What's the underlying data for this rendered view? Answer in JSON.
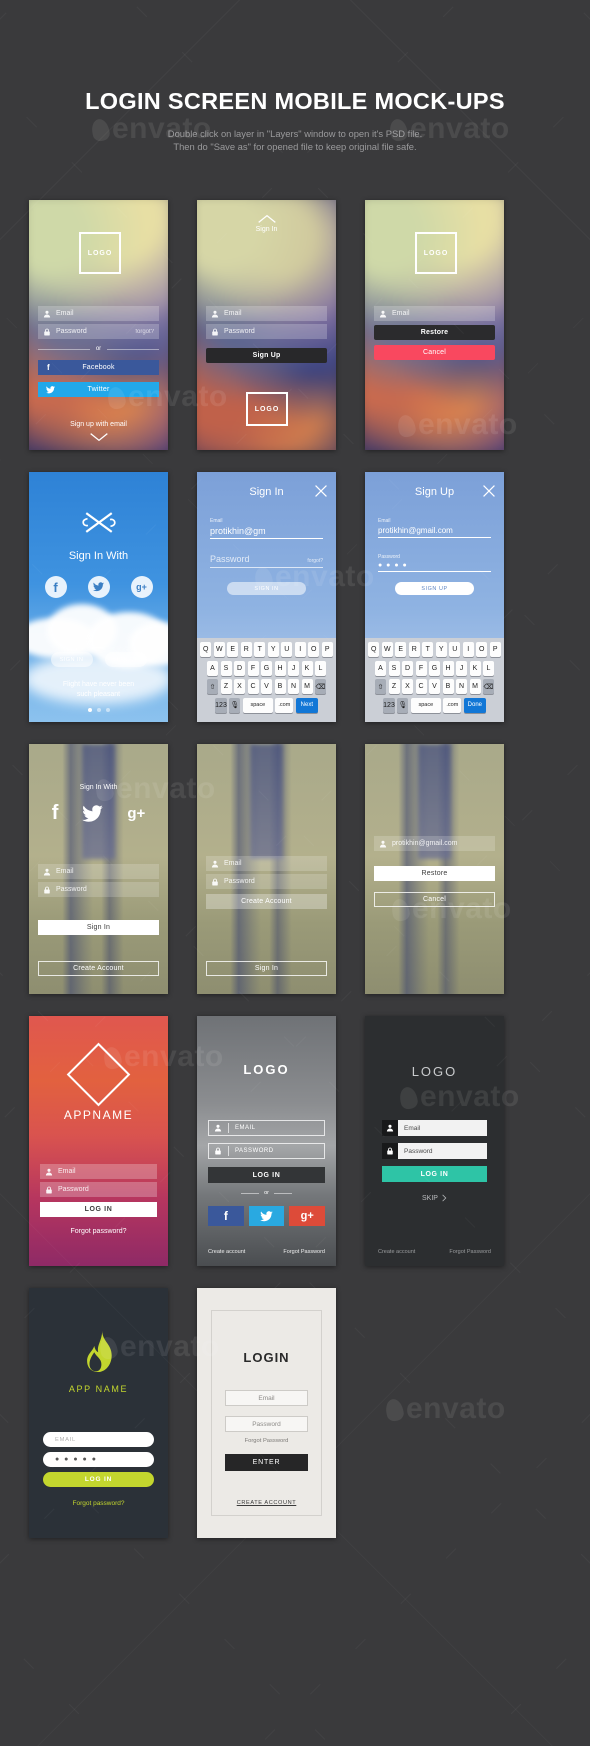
{
  "header": {
    "title": "LOGIN SCREEN MOBILE MOCK-UPS",
    "sub_line1": "Double click on layer in \"Layers\" window to open it's PSD file.",
    "sub_line2": "Then do \"Save as\" for opened file to keep original file safe."
  },
  "watermark": {
    "text": "envato"
  },
  "colors": {
    "page_bg": "#3a3a3c",
    "facebook": "#3a589b",
    "twitter": "#1da1f2",
    "google": "#dd4b39",
    "cancel_pink": "#f9485f",
    "teal": "#2ec4a6",
    "lime": "#c3d62e",
    "keyboard_go": "#1277d6"
  },
  "screens": [
    {
      "id": "s1",
      "name": "signup-social-blur",
      "logo": "LOGO",
      "email_placeholder": "Email",
      "password_placeholder": "Password",
      "forgot": "forgot?",
      "or": "or",
      "facebook": "Facebook",
      "twitter": "Twitter",
      "bottom": "Sign up with email"
    },
    {
      "id": "s2",
      "name": "signup-blur",
      "top_title": "Sign In",
      "email_placeholder": "Email",
      "password_placeholder": "Password",
      "signup": "Sign Up",
      "logo": "LOGO"
    },
    {
      "id": "s3",
      "name": "restore-blur",
      "logo": "LOGO",
      "email_placeholder": "Email",
      "restore": "Restore",
      "cancel": "Cancel"
    },
    {
      "id": "s4",
      "name": "sign-in-with-sky",
      "title": "Sign In With",
      "socials": [
        "f",
        "twitter",
        "g+"
      ],
      "btn_signin": "SIGN IN",
      "btn_signup": "SIGN UP",
      "tagline_line1": "Flight have never been",
      "tagline_line2": "such pleasant",
      "dots": 3
    },
    {
      "id": "s5",
      "name": "sign-in-keyboard",
      "title": "Sign In",
      "email_label": "Email",
      "email_value": "protikhin@gm",
      "password_label": "Password",
      "forgot": "forgot?",
      "button": "SIGN IN",
      "keyboard": {
        "row1": [
          "Q",
          "W",
          "E",
          "R",
          "T",
          "Y",
          "U",
          "I",
          "O",
          "P"
        ],
        "row2": [
          "A",
          "S",
          "D",
          "F",
          "G",
          "H",
          "J",
          "K",
          "L"
        ],
        "row3": [
          "Z",
          "X",
          "C",
          "V",
          "B",
          "N",
          "M"
        ],
        "num": "123",
        "space": "space",
        "dot_com": ".com",
        "action": "Next"
      }
    },
    {
      "id": "s6",
      "name": "sign-up-keyboard",
      "title": "Sign Up",
      "email_label": "Email",
      "email_value": "protikhin@gmail.com",
      "password_label": "Password",
      "password_value": "● ● ● ●",
      "button": "SIGN UP",
      "keyboard": {
        "row1": [
          "Q",
          "W",
          "E",
          "R",
          "T",
          "Y",
          "U",
          "I",
          "O",
          "P"
        ],
        "row2": [
          "A",
          "S",
          "D",
          "F",
          "G",
          "H",
          "J",
          "K",
          "L"
        ],
        "row3": [
          "Z",
          "X",
          "C",
          "V",
          "B",
          "N",
          "M"
        ],
        "num": "123",
        "space": "space",
        "dot_com": ".com",
        "action": "Done"
      }
    },
    {
      "id": "s7",
      "name": "sign-in-with-desert",
      "title": "Sign In With",
      "email_placeholder": "Email",
      "password_placeholder": "Password",
      "btn_signin": "Sign In",
      "btn_create": "Create Account"
    },
    {
      "id": "s8",
      "name": "create-account-desert",
      "email_placeholder": "Email",
      "password_placeholder": "Password",
      "btn_create": "Create Account",
      "btn_signin": "Sign In"
    },
    {
      "id": "s9",
      "name": "restore-desert",
      "email_value": "protikhin@gmail.com",
      "btn_restore": "Restore",
      "btn_cancel": "Cancel"
    },
    {
      "id": "s10",
      "name": "appname-sunset",
      "appname": "APPNAME",
      "email_placeholder": "Email",
      "password_placeholder": "Password",
      "login": "LOG IN",
      "forgot": "Forgot password?"
    },
    {
      "id": "s11",
      "name": "logo-gray-social",
      "logo": "LOGO",
      "email_placeholder": "EMAIL",
      "password_placeholder": "PASSWORD",
      "login": "LOG IN",
      "or": "or",
      "socials": [
        "f",
        "twitter",
        "g+"
      ],
      "create": "Create account",
      "forgot": "Forgot Password"
    },
    {
      "id": "s12",
      "name": "logo-dark-teal",
      "logo": "LOGO",
      "email_placeholder": "Email",
      "password_placeholder": "Password",
      "login": "LOG IN",
      "skip": "SKIP",
      "create": "Create account",
      "forgot": "Forgot Password"
    },
    {
      "id": "s13",
      "name": "flame-appname",
      "appname": "APP NAME",
      "email_placeholder": "EMAIL",
      "password_value": "● ● ● ● ●",
      "login": "LOG IN",
      "forgot": "Forgot password?"
    },
    {
      "id": "s14",
      "name": "login-light",
      "title": "LOGIN",
      "email_placeholder": "Email",
      "password_placeholder": "Password",
      "forgot": "Forgot Password",
      "enter": "ENTER",
      "create": "CREATE ACCOUNT"
    }
  ]
}
